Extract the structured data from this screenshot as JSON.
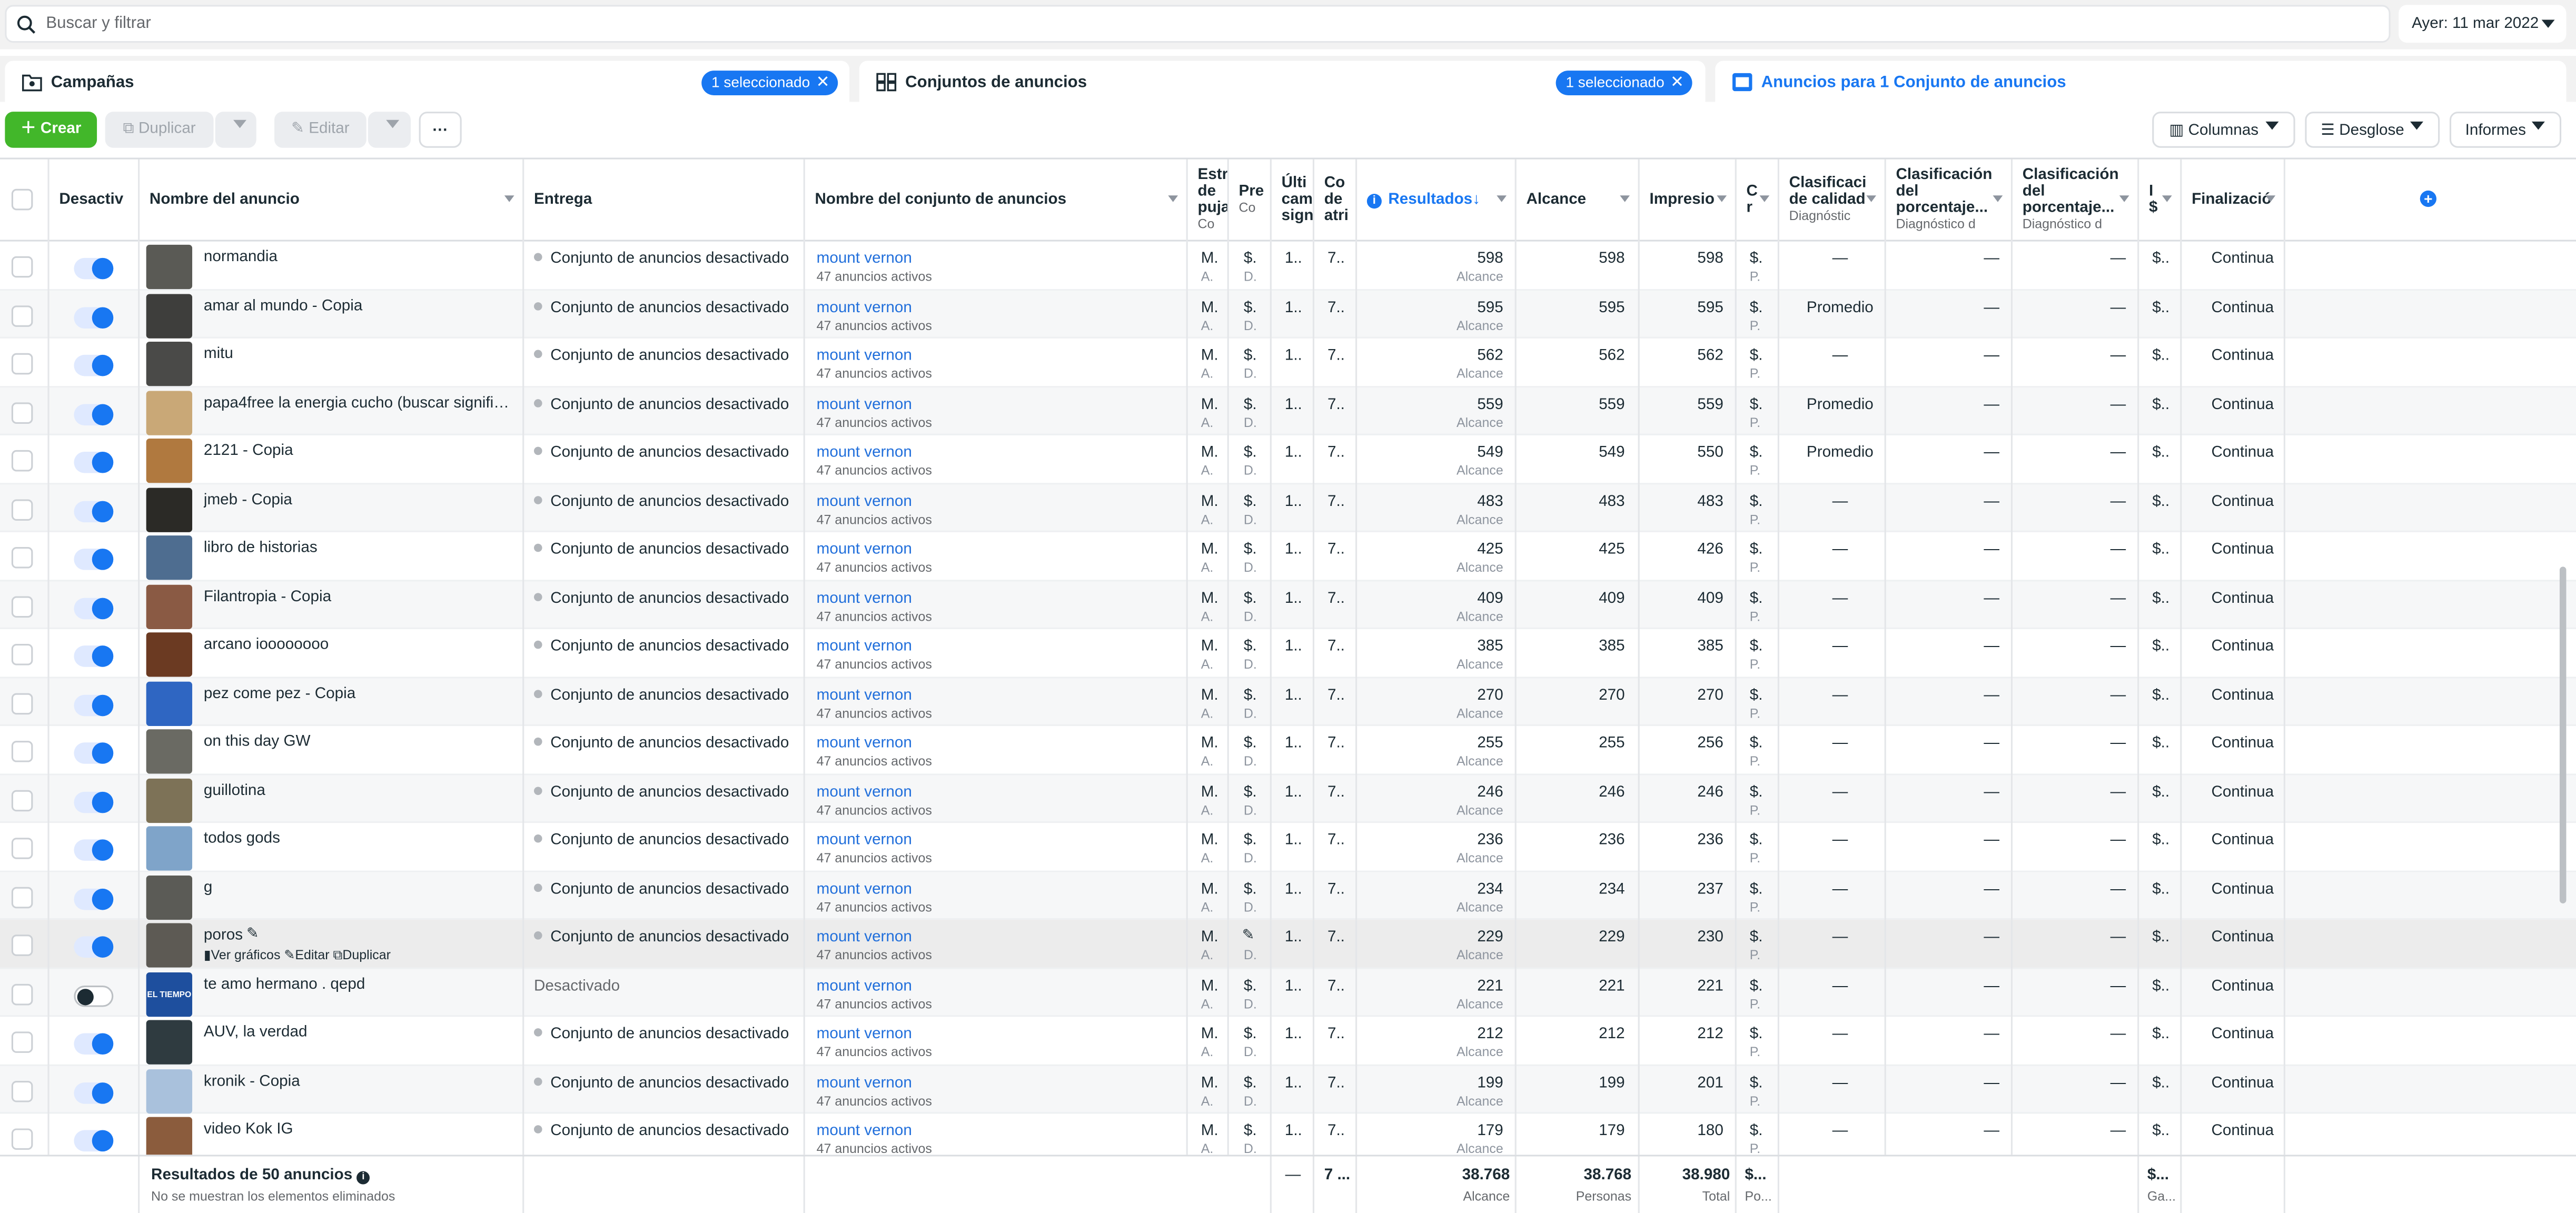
{
  "search": {
    "placeholder": "Buscar y filtrar"
  },
  "date": {
    "label": "Ayer: 11 mar 2022"
  },
  "panels": {
    "campaigns": {
      "title": "Campañas",
      "pill": "1 seleccionado"
    },
    "adsets": {
      "title": "Conjuntos de anuncios",
      "pill": "1 seleccionado"
    },
    "ads": {
      "title": "Anuncios para 1 Conjunto de anuncios"
    }
  },
  "toolbar": {
    "create": "Crear",
    "duplicate": "Duplicar",
    "edit": "Editar",
    "more": "···",
    "columns": "Columnas",
    "breakdown": "Desglose",
    "reports": "Informes"
  },
  "headers": {
    "off": "Desactiv",
    "name": "Nombre del anuncio",
    "delivery": "Entrega",
    "adset": "Nombre del conjunto de anuncios",
    "bid": "Estr de puja",
    "bid_sub": "Co",
    "budget": "Pre",
    "budget_sub": "Co",
    "last": "Últi cam sign",
    "attr": "Co de atri",
    "results": "Resultados",
    "reach": "Alcance",
    "impr": "Impresio",
    "cost": "C r",
    "q1": "Clasificaci de calidad",
    "q1_sub": "Diagnóstic",
    "q2": "Clasificación del porcentaje...",
    "q2_sub": "Diagnóstico d",
    "q3": "Clasificación del porcentaje...",
    "q3_sub": "Diagnóstico d",
    "spent": "I $",
    "end": "Finalizació"
  },
  "common": {
    "delivery_text": "Conjunto de anuncios desactivado",
    "adset_name": "mount vernon",
    "adset_sub": "47 anuncios activos",
    "bid_val": "M.",
    "bid_sub": "A.",
    "budget_val": "$.",
    "budget_sub": "D.",
    "last_val": "1..",
    "attr_val": "7..",
    "res_sub": "Alcance",
    "cost_val": "$.",
    "cost_sub": "P.",
    "dash": "—",
    "spent_val": "$..",
    "end_val": "Continua",
    "edit_icon": "pencil-icon"
  },
  "rows": [
    {
      "name": "normandia",
      "res": "598",
      "reach": "598",
      "impr": "598",
      "q1": "—",
      "thumb": "#5a5a55",
      "on": true
    },
    {
      "name": "amar al mundo - Copia",
      "res": "595",
      "reach": "595",
      "impr": "595",
      "q1": "Promedio",
      "thumb": "#3e3e3c",
      "on": true
    },
    {
      "name": "mitu",
      "res": "562",
      "reach": "562",
      "impr": "562",
      "q1": "—",
      "thumb": "#4a4a48",
      "on": true
    },
    {
      "name": "papa4free la energia cucho (buscar significa...",
      "res": "559",
      "reach": "559",
      "impr": "559",
      "q1": "Promedio",
      "thumb": "#c9a877",
      "on": true
    },
    {
      "name": "2121 - Copia",
      "res": "549",
      "reach": "549",
      "impr": "550",
      "q1": "Promedio",
      "thumb": "#b0793f",
      "on": true
    },
    {
      "name": "jmeb - Copia",
      "res": "483",
      "reach": "483",
      "impr": "483",
      "q1": "—",
      "thumb": "#2b2a26",
      "on": true
    },
    {
      "name": "libro de historias",
      "res": "425",
      "reach": "425",
      "impr": "426",
      "q1": "—",
      "thumb": "#4e6d90",
      "on": true
    },
    {
      "name": "Filantropia - Copia",
      "res": "409",
      "reach": "409",
      "impr": "409",
      "q1": "—",
      "thumb": "#8a5a44",
      "on": true
    },
    {
      "name": "arcano ioooooooo",
      "res": "385",
      "reach": "385",
      "impr": "385",
      "q1": "—",
      "thumb": "#6b3a22",
      "on": true
    },
    {
      "name": "pez come pez - Copia",
      "res": "270",
      "reach": "270",
      "impr": "270",
      "q1": "—",
      "thumb": "#2f66c2",
      "on": true
    },
    {
      "name": "on this day GW",
      "res": "255",
      "reach": "255",
      "impr": "256",
      "q1": "—",
      "thumb": "#6a6a63",
      "on": true
    },
    {
      "name": "guillotina",
      "res": "246",
      "reach": "246",
      "impr": "246",
      "q1": "—",
      "thumb": "#7d7257",
      "on": true
    },
    {
      "name": "todos gods",
      "res": "236",
      "reach": "236",
      "impr": "236",
      "q1": "—",
      "thumb": "#7fa4c9",
      "on": true
    },
    {
      "name": "g",
      "res": "234",
      "reach": "234",
      "impr": "237",
      "q1": "—",
      "thumb": "#5b5b56",
      "on": true
    },
    {
      "name": "poros",
      "res": "229",
      "reach": "229",
      "impr": "230",
      "q1": "—",
      "thumb": "#5d5a54",
      "on": true,
      "hover": true
    },
    {
      "name": "te amo hermano . qepd",
      "res": "221",
      "reach": "221",
      "impr": "221",
      "q1": "—",
      "thumb": "#1e4f9e",
      "on": false,
      "delivery": "Desactivado",
      "thumb_text": "EL TIEMPO"
    },
    {
      "name": "AUV, la verdad",
      "res": "212",
      "reach": "212",
      "impr": "212",
      "q1": "—",
      "thumb": "#2f3b40",
      "on": true
    },
    {
      "name": "kronik - Copia",
      "res": "199",
      "reach": "199",
      "impr": "201",
      "q1": "—",
      "thumb": "#a9c1dc",
      "on": true
    },
    {
      "name": "video Kok IG",
      "res": "179",
      "reach": "179",
      "impr": "180",
      "q1": "—",
      "thumb": "#8b5c3d",
      "on": true
    }
  ],
  "hover_actions": {
    "charts": "Ver gráficos",
    "edit": "Editar",
    "dup": "Duplicar"
  },
  "footer": {
    "title": "Resultados de 50 anuncios",
    "sub": "No se muestran los elementos eliminados",
    "dash": "—",
    "attr": "7 ...",
    "res": "38.768",
    "res_sub": "Alcance",
    "reach": "38.768",
    "reach_sub": "Personas",
    "impr": "38.980",
    "impr_sub": "Total",
    "cost": "$...",
    "cost_sub": "Po...",
    "spent": "$...",
    "spent_sub": "Ga..."
  },
  "colors": {
    "accent": "#1877f2",
    "create": "#42b72a",
    "link": "#216fdb"
  }
}
